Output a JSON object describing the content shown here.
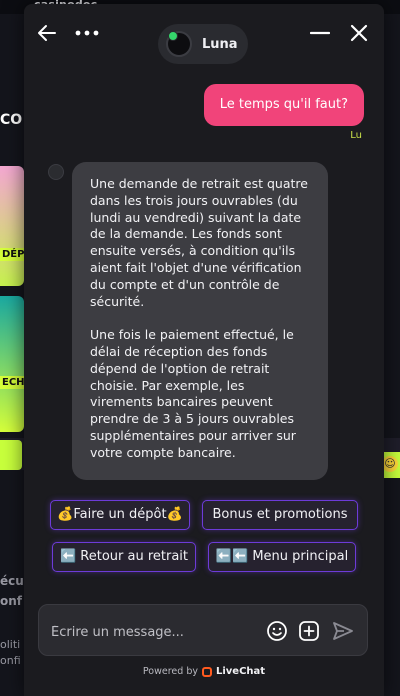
{
  "background": {
    "site_logo": "casinodoc",
    "edge_text_1": "CO",
    "edge_text_2": "DÉP",
    "edge_text_3": "ECH",
    "edge_text_4": "écu",
    "edge_text_5": "onf",
    "edge_text_6": "oliti",
    "edge_text_7": "onfi"
  },
  "header": {
    "back_icon": "arrow-left-icon",
    "more_icon": "more-dots-icon",
    "agent_name": "Luna",
    "minimize_icon": "minimize-icon",
    "close_icon": "close-icon",
    "online_color": "#35d56b"
  },
  "messages": {
    "user": {
      "text": "Le temps qu'il faut?",
      "author_tag": "Lu",
      "color": "#f1447a"
    },
    "bot": {
      "paragraphs": [
        "Une demande de retrait est quatre dans les trois jours ouvrables (du lundi au vendredi) suivant la date de la demande. Les fonds sont ensuite versés, à condition qu'ils aient fait l'objet d'une vérification du compte et d'un contrôle de sécurité.",
        "Une fois le paiement effectué, le délai de réception des fonds dépend de l'option de retrait choisie. Par exemple, les virements bancaires peuvent prendre de 3 à 5 jours ouvrables supplémentaires pour arriver sur votre compte bancaire."
      ]
    }
  },
  "quick_replies": [
    "💰Faire un dépôt💰",
    "Bonus et promotions",
    "⬅️ Retour au retrait",
    "⬅️⬅️ Menu principal"
  ],
  "composer": {
    "placeholder": "Écrire un message...",
    "emoji_icon": "emoji-icon",
    "attach_icon": "plus-square-icon",
    "send_icon": "send-icon"
  },
  "footer": {
    "powered_by": "Powered by",
    "brand": "LiveChat",
    "brand_color": "#ff5a1f"
  },
  "accent_color": "#6d3bd8"
}
